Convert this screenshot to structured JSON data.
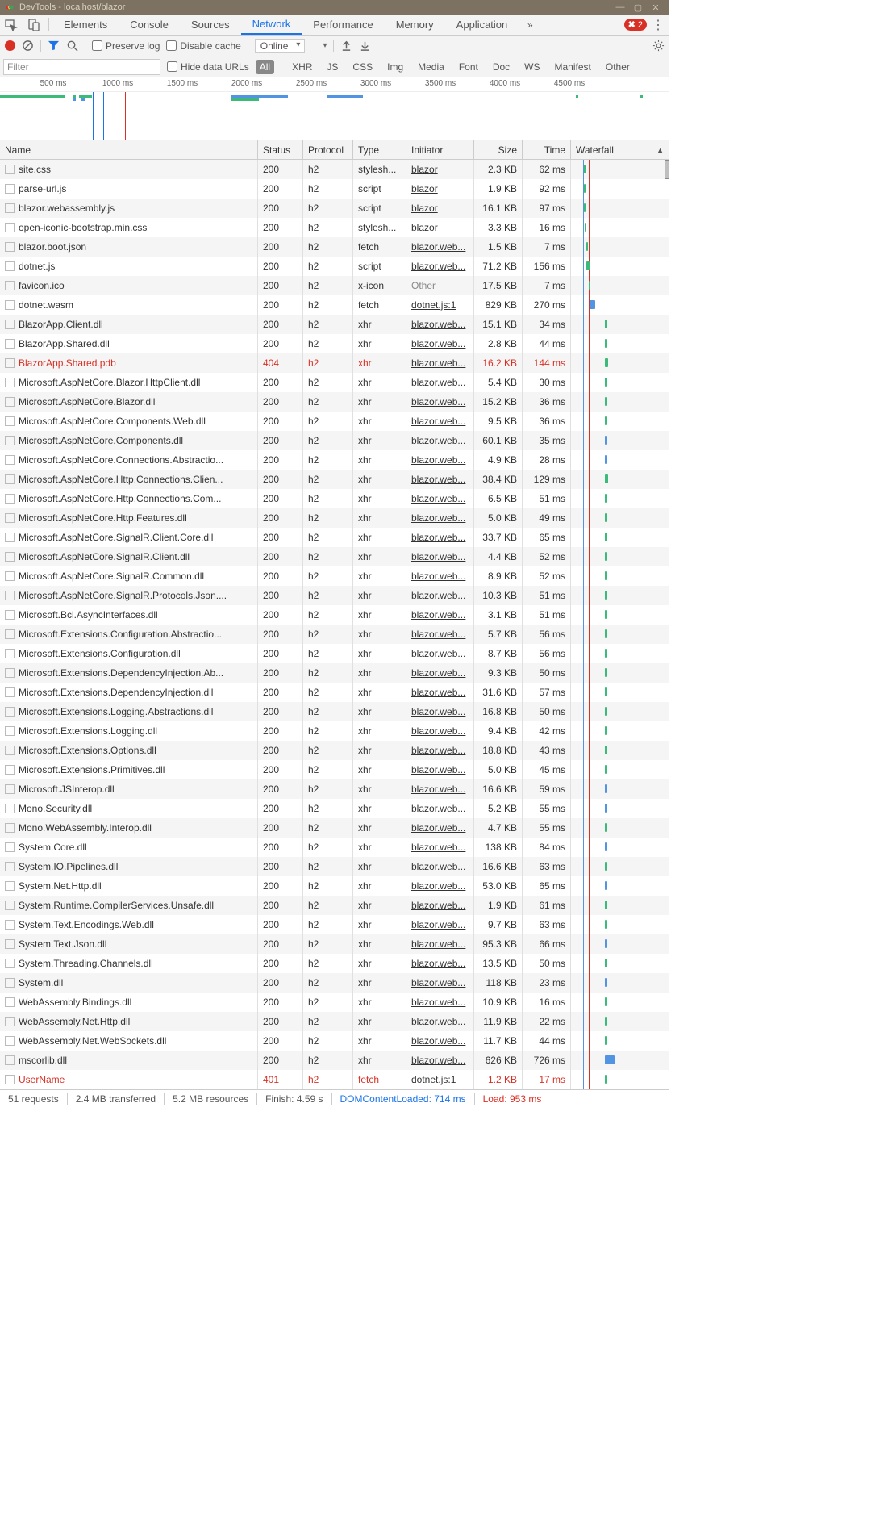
{
  "title": "DevTools - localhost/blazor",
  "tabs": [
    "Elements",
    "Console",
    "Sources",
    "Network",
    "Performance",
    "Memory",
    "Application"
  ],
  "active_tab": "Network",
  "error_count": "2",
  "toolbar": {
    "preserve_log": "Preserve log",
    "disable_cache": "Disable cache",
    "throttling": "Online"
  },
  "filterbar": {
    "filter_placeholder": "Filter",
    "hide_urls": "Hide data URLs",
    "types": [
      "All",
      "XHR",
      "JS",
      "CSS",
      "Img",
      "Media",
      "Font",
      "Doc",
      "WS",
      "Manifest",
      "Other"
    ]
  },
  "timeline_ticks": [
    "500 ms",
    "1000 ms",
    "1500 ms",
    "2000 ms",
    "2500 ms",
    "3000 ms",
    "3500 ms",
    "4000 ms",
    "4500 ms"
  ],
  "columns": {
    "name": "Name",
    "status": "Status",
    "protocol": "Protocol",
    "type": "Type",
    "initiator": "Initiator",
    "size": "Size",
    "time": "Time",
    "waterfall": "Waterfall"
  },
  "rows": [
    {
      "name": "site.css",
      "status": "200",
      "protocol": "h2",
      "type": "stylesh...",
      "initiator": "blazor",
      "size": "2.3 KB",
      "time": "62 ms",
      "wcolor": "#3bba7a",
      "wleft": 16,
      "wwidth": 2
    },
    {
      "name": "parse-url.js",
      "status": "200",
      "protocol": "h2",
      "type": "script",
      "initiator": "blazor",
      "size": "1.9 KB",
      "time": "92 ms",
      "wcolor": "#3bba7a",
      "wleft": 16,
      "wwidth": 2
    },
    {
      "name": "blazor.webassembly.js",
      "status": "200",
      "protocol": "h2",
      "type": "script",
      "initiator": "blazor",
      "size": "16.1 KB",
      "time": "97 ms",
      "wcolor": "#3bba7a",
      "wleft": 16,
      "wwidth": 2
    },
    {
      "name": "open-iconic-bootstrap.min.css",
      "status": "200",
      "protocol": "h2",
      "type": "stylesh...",
      "initiator": "blazor",
      "size": "3.3 KB",
      "time": "16 ms",
      "wcolor": "#3bba7a",
      "wleft": 17,
      "wwidth": 2
    },
    {
      "name": "blazor.boot.json",
      "status": "200",
      "protocol": "h2",
      "type": "fetch",
      "initiator": "blazor.web...",
      "size": "1.5 KB",
      "time": "7 ms",
      "wcolor": "#3bba7a",
      "wleft": 19,
      "wwidth": 2
    },
    {
      "name": "dotnet.js",
      "status": "200",
      "protocol": "h2",
      "type": "script",
      "initiator": "blazor.web...",
      "size": "71.2 KB",
      "time": "156 ms",
      "wcolor": "#3bba7a",
      "wleft": 19,
      "wwidth": 4
    },
    {
      "name": "favicon.ico",
      "status": "200",
      "protocol": "h2",
      "type": "x-icon",
      "initiator": "Other",
      "initiator_grey": true,
      "size": "17.5 KB",
      "time": "7 ms",
      "wcolor": "#3bba7a",
      "wleft": 22,
      "wwidth": 2
    },
    {
      "name": "dotnet.wasm",
      "status": "200",
      "protocol": "h2",
      "type": "fetch",
      "initiator": "dotnet.js:1",
      "size": "829 KB",
      "time": "270 ms",
      "wcolor": "#5294e2",
      "wleft": 23,
      "wwidth": 7
    },
    {
      "name": "BlazorApp.Client.dll",
      "status": "200",
      "protocol": "h2",
      "type": "xhr",
      "initiator": "blazor.web...",
      "size": "15.1 KB",
      "time": "34 ms",
      "wcolor": "#3bba7a",
      "wleft": 42,
      "wwidth": 3
    },
    {
      "name": "BlazorApp.Shared.dll",
      "status": "200",
      "protocol": "h2",
      "type": "xhr",
      "initiator": "blazor.web...",
      "size": "2.8 KB",
      "time": "44 ms",
      "wcolor": "#3bba7a",
      "wleft": 42,
      "wwidth": 3
    },
    {
      "name": "BlazorApp.Shared.pdb",
      "status": "404",
      "protocol": "h2",
      "type": "xhr",
      "initiator": "blazor.web...",
      "size": "16.2 KB",
      "time": "144 ms",
      "error": true,
      "wcolor": "#3bba7a",
      "wleft": 42,
      "wwidth": 4
    },
    {
      "name": "Microsoft.AspNetCore.Blazor.HttpClient.dll",
      "status": "200",
      "protocol": "h2",
      "type": "xhr",
      "initiator": "blazor.web...",
      "size": "5.4 KB",
      "time": "30 ms",
      "wcolor": "#3bba7a",
      "wleft": 42,
      "wwidth": 3
    },
    {
      "name": "Microsoft.AspNetCore.Blazor.dll",
      "status": "200",
      "protocol": "h2",
      "type": "xhr",
      "initiator": "blazor.web...",
      "size": "15.2 KB",
      "time": "36 ms",
      "wcolor": "#3bba7a",
      "wleft": 42,
      "wwidth": 3
    },
    {
      "name": "Microsoft.AspNetCore.Components.Web.dll",
      "status": "200",
      "protocol": "h2",
      "type": "xhr",
      "initiator": "blazor.web...",
      "size": "9.5 KB",
      "time": "36 ms",
      "wcolor": "#3bba7a",
      "wleft": 42,
      "wwidth": 3
    },
    {
      "name": "Microsoft.AspNetCore.Components.dll",
      "status": "200",
      "protocol": "h2",
      "type": "xhr",
      "initiator": "blazor.web...",
      "size": "60.1 KB",
      "time": "35 ms",
      "wcolor": "#5294e2",
      "wleft": 42,
      "wwidth": 3
    },
    {
      "name": "Microsoft.AspNetCore.Connections.Abstractio...",
      "status": "200",
      "protocol": "h2",
      "type": "xhr",
      "initiator": "blazor.web...",
      "size": "4.9 KB",
      "time": "28 ms",
      "wcolor": "#5294e2",
      "wleft": 42,
      "wwidth": 3
    },
    {
      "name": "Microsoft.AspNetCore.Http.Connections.Clien...",
      "status": "200",
      "protocol": "h2",
      "type": "xhr",
      "initiator": "blazor.web...",
      "size": "38.4 KB",
      "time": "129 ms",
      "wcolor": "#3bba7a",
      "wleft": 42,
      "wwidth": 4
    },
    {
      "name": "Microsoft.AspNetCore.Http.Connections.Com...",
      "status": "200",
      "protocol": "h2",
      "type": "xhr",
      "initiator": "blazor.web...",
      "size": "6.5 KB",
      "time": "51 ms",
      "wcolor": "#3bba7a",
      "wleft": 42,
      "wwidth": 3
    },
    {
      "name": "Microsoft.AspNetCore.Http.Features.dll",
      "status": "200",
      "protocol": "h2",
      "type": "xhr",
      "initiator": "blazor.web...",
      "size": "5.0 KB",
      "time": "49 ms",
      "wcolor": "#3bba7a",
      "wleft": 42,
      "wwidth": 3
    },
    {
      "name": "Microsoft.AspNetCore.SignalR.Client.Core.dll",
      "status": "200",
      "protocol": "h2",
      "type": "xhr",
      "initiator": "blazor.web...",
      "size": "33.7 KB",
      "time": "65 ms",
      "wcolor": "#3bba7a",
      "wleft": 42,
      "wwidth": 3
    },
    {
      "name": "Microsoft.AspNetCore.SignalR.Client.dll",
      "status": "200",
      "protocol": "h2",
      "type": "xhr",
      "initiator": "blazor.web...",
      "size": "4.4 KB",
      "time": "52 ms",
      "wcolor": "#3bba7a",
      "wleft": 42,
      "wwidth": 3
    },
    {
      "name": "Microsoft.AspNetCore.SignalR.Common.dll",
      "status": "200",
      "protocol": "h2",
      "type": "xhr",
      "initiator": "blazor.web...",
      "size": "8.9 KB",
      "time": "52 ms",
      "wcolor": "#3bba7a",
      "wleft": 42,
      "wwidth": 3
    },
    {
      "name": "Microsoft.AspNetCore.SignalR.Protocols.Json....",
      "status": "200",
      "protocol": "h2",
      "type": "xhr",
      "initiator": "blazor.web...",
      "size": "10.3 KB",
      "time": "51 ms",
      "wcolor": "#3bba7a",
      "wleft": 42,
      "wwidth": 3
    },
    {
      "name": "Microsoft.Bcl.AsyncInterfaces.dll",
      "status": "200",
      "protocol": "h2",
      "type": "xhr",
      "initiator": "blazor.web...",
      "size": "3.1 KB",
      "time": "51 ms",
      "wcolor": "#3bba7a",
      "wleft": 42,
      "wwidth": 3
    },
    {
      "name": "Microsoft.Extensions.Configuration.Abstractio...",
      "status": "200",
      "protocol": "h2",
      "type": "xhr",
      "initiator": "blazor.web...",
      "size": "5.7 KB",
      "time": "56 ms",
      "wcolor": "#3bba7a",
      "wleft": 42,
      "wwidth": 3
    },
    {
      "name": "Microsoft.Extensions.Configuration.dll",
      "status": "200",
      "protocol": "h2",
      "type": "xhr",
      "initiator": "blazor.web...",
      "size": "8.7 KB",
      "time": "56 ms",
      "wcolor": "#3bba7a",
      "wleft": 42,
      "wwidth": 3
    },
    {
      "name": "Microsoft.Extensions.DependencyInjection.Ab...",
      "status": "200",
      "protocol": "h2",
      "type": "xhr",
      "initiator": "blazor.web...",
      "size": "9.3 KB",
      "time": "50 ms",
      "wcolor": "#3bba7a",
      "wleft": 42,
      "wwidth": 3
    },
    {
      "name": "Microsoft.Extensions.DependencyInjection.dll",
      "status": "200",
      "protocol": "h2",
      "type": "xhr",
      "initiator": "blazor.web...",
      "size": "31.6 KB",
      "time": "57 ms",
      "wcolor": "#3bba7a",
      "wleft": 42,
      "wwidth": 3
    },
    {
      "name": "Microsoft.Extensions.Logging.Abstractions.dll",
      "status": "200",
      "protocol": "h2",
      "type": "xhr",
      "initiator": "blazor.web...",
      "size": "16.8 KB",
      "time": "50 ms",
      "wcolor": "#3bba7a",
      "wleft": 42,
      "wwidth": 3
    },
    {
      "name": "Microsoft.Extensions.Logging.dll",
      "status": "200",
      "protocol": "h2",
      "type": "xhr",
      "initiator": "blazor.web...",
      "size": "9.4 KB",
      "time": "42 ms",
      "wcolor": "#3bba7a",
      "wleft": 42,
      "wwidth": 3
    },
    {
      "name": "Microsoft.Extensions.Options.dll",
      "status": "200",
      "protocol": "h2",
      "type": "xhr",
      "initiator": "blazor.web...",
      "size": "18.8 KB",
      "time": "43 ms",
      "wcolor": "#3bba7a",
      "wleft": 42,
      "wwidth": 3
    },
    {
      "name": "Microsoft.Extensions.Primitives.dll",
      "status": "200",
      "protocol": "h2",
      "type": "xhr",
      "initiator": "blazor.web...",
      "size": "5.0 KB",
      "time": "45 ms",
      "wcolor": "#3bba7a",
      "wleft": 42,
      "wwidth": 3
    },
    {
      "name": "Microsoft.JSInterop.dll",
      "status": "200",
      "protocol": "h2",
      "type": "xhr",
      "initiator": "blazor.web...",
      "size": "16.6 KB",
      "time": "59 ms",
      "wcolor": "#5294e2",
      "wleft": 42,
      "wwidth": 3
    },
    {
      "name": "Mono.Security.dll",
      "status": "200",
      "protocol": "h2",
      "type": "xhr",
      "initiator": "blazor.web...",
      "size": "5.2 KB",
      "time": "55 ms",
      "wcolor": "#5294e2",
      "wleft": 42,
      "wwidth": 3
    },
    {
      "name": "Mono.WebAssembly.Interop.dll",
      "status": "200",
      "protocol": "h2",
      "type": "xhr",
      "initiator": "blazor.web...",
      "size": "4.7 KB",
      "time": "55 ms",
      "wcolor": "#3bba7a",
      "wleft": 42,
      "wwidth": 3
    },
    {
      "name": "System.Core.dll",
      "status": "200",
      "protocol": "h2",
      "type": "xhr",
      "initiator": "blazor.web...",
      "size": "138 KB",
      "time": "84 ms",
      "wcolor": "#5294e2",
      "wleft": 42,
      "wwidth": 3
    },
    {
      "name": "System.IO.Pipelines.dll",
      "status": "200",
      "protocol": "h2",
      "type": "xhr",
      "initiator": "blazor.web...",
      "size": "16.6 KB",
      "time": "63 ms",
      "wcolor": "#3bba7a",
      "wleft": 42,
      "wwidth": 3
    },
    {
      "name": "System.Net.Http.dll",
      "status": "200",
      "protocol": "h2",
      "type": "xhr",
      "initiator": "blazor.web...",
      "size": "53.0 KB",
      "time": "65 ms",
      "wcolor": "#5294e2",
      "wleft": 42,
      "wwidth": 3
    },
    {
      "name": "System.Runtime.CompilerServices.Unsafe.dll",
      "status": "200",
      "protocol": "h2",
      "type": "xhr",
      "initiator": "blazor.web...",
      "size": "1.9 KB",
      "time": "61 ms",
      "wcolor": "#3bba7a",
      "wleft": 42,
      "wwidth": 3
    },
    {
      "name": "System.Text.Encodings.Web.dll",
      "status": "200",
      "protocol": "h2",
      "type": "xhr",
      "initiator": "blazor.web...",
      "size": "9.7 KB",
      "time": "63 ms",
      "wcolor": "#3bba7a",
      "wleft": 42,
      "wwidth": 3
    },
    {
      "name": "System.Text.Json.dll",
      "status": "200",
      "protocol": "h2",
      "type": "xhr",
      "initiator": "blazor.web...",
      "size": "95.3 KB",
      "time": "66 ms",
      "wcolor": "#5294e2",
      "wleft": 42,
      "wwidth": 3
    },
    {
      "name": "System.Threading.Channels.dll",
      "status": "200",
      "protocol": "h2",
      "type": "xhr",
      "initiator": "blazor.web...",
      "size": "13.5 KB",
      "time": "50 ms",
      "wcolor": "#3bba7a",
      "wleft": 42,
      "wwidth": 3
    },
    {
      "name": "System.dll",
      "status": "200",
      "protocol": "h2",
      "type": "xhr",
      "initiator": "blazor.web...",
      "size": "118 KB",
      "time": "23 ms",
      "wcolor": "#5294e2",
      "wleft": 42,
      "wwidth": 3
    },
    {
      "name": "WebAssembly.Bindings.dll",
      "status": "200",
      "protocol": "h2",
      "type": "xhr",
      "initiator": "blazor.web...",
      "size": "10.9 KB",
      "time": "16 ms",
      "wcolor": "#3bba7a",
      "wleft": 42,
      "wwidth": 3
    },
    {
      "name": "WebAssembly.Net.Http.dll",
      "status": "200",
      "protocol": "h2",
      "type": "xhr",
      "initiator": "blazor.web...",
      "size": "11.9 KB",
      "time": "22 ms",
      "wcolor": "#3bba7a",
      "wleft": 42,
      "wwidth": 3
    },
    {
      "name": "WebAssembly.Net.WebSockets.dll",
      "status": "200",
      "protocol": "h2",
      "type": "xhr",
      "initiator": "blazor.web...",
      "size": "11.7 KB",
      "time": "44 ms",
      "wcolor": "#3bba7a",
      "wleft": 42,
      "wwidth": 3
    },
    {
      "name": "mscorlib.dll",
      "status": "200",
      "protocol": "h2",
      "type": "xhr",
      "initiator": "blazor.web...",
      "size": "626 KB",
      "time": "726 ms",
      "wcolor": "#5294e2",
      "wleft": 42,
      "wwidth": 12
    },
    {
      "name": "UserName",
      "status": "401",
      "protocol": "h2",
      "type": "fetch",
      "initiator": "dotnet.js:1",
      "size": "1.2 KB",
      "time": "17 ms",
      "error": true,
      "wcolor": "#3bba7a",
      "wleft": 42,
      "wwidth": 3
    }
  ],
  "statusbar": {
    "requests": "51 requests",
    "transferred": "2.4 MB transferred",
    "resources": "5.2 MB resources",
    "finish": "Finish: 4.59 s",
    "dom": "DOMContentLoaded: 714 ms",
    "load": "Load: 953 ms"
  }
}
